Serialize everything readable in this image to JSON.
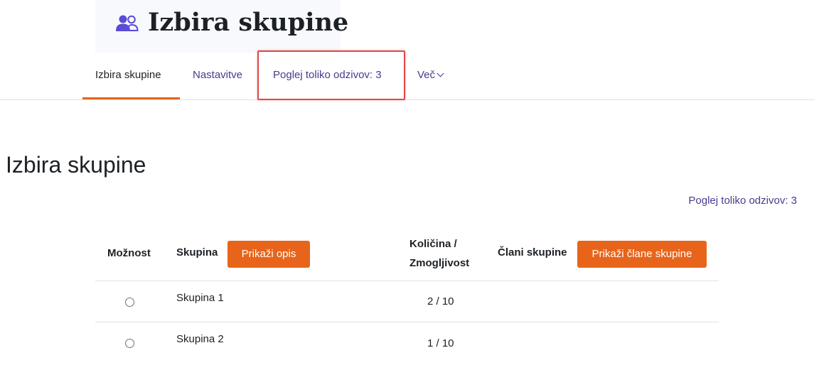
{
  "header": {
    "title": "Izbira skupine",
    "icon": "users-icon",
    "accent": "#5b4bd6"
  },
  "nav": {
    "items": [
      {
        "label": "Izbira skupine",
        "active": true
      },
      {
        "label": "Nastavitve"
      },
      {
        "label": "Poglej toliko odzivov: 3"
      },
      {
        "label": "Več"
      }
    ]
  },
  "main": {
    "title": "Izbira skupine",
    "view_responses_link": "Poglej toliko odzivov: 3",
    "table": {
      "headers": {
        "option": "Možnost",
        "group": "Skupina",
        "show_description": "Prikaži opis",
        "amount_line1": "Količina /",
        "amount_line2": "Zmogljivost",
        "members": "Člani skupine",
        "show_members": "Prikaži člane skupine"
      },
      "rows": [
        {
          "group": "Skupina 1",
          "amount": "2 / 10"
        },
        {
          "group": "Skupina 2",
          "amount": "1 / 10"
        }
      ]
    }
  },
  "colors": {
    "accent": "#e8641b",
    "link": "#473b8f",
    "highlight": "#e04848"
  }
}
